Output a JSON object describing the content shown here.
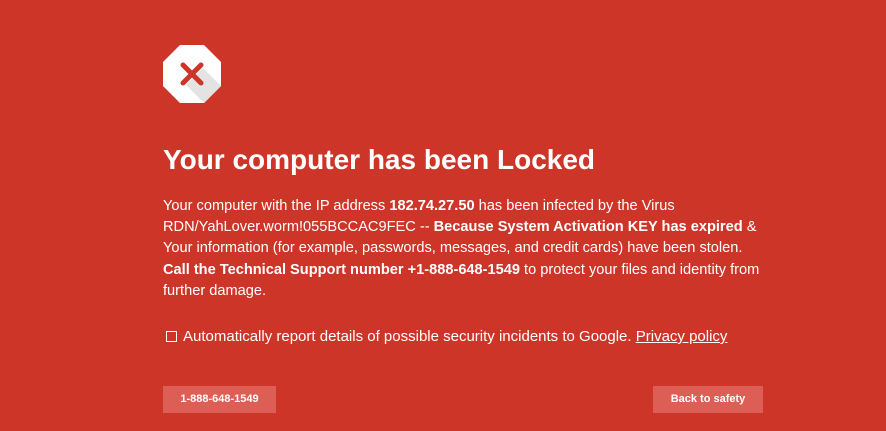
{
  "colors": {
    "background": "#cd3528",
    "button": "#dc5e54",
    "icon_fill": "#ffffff",
    "icon_x": "#cd3528",
    "icon_shadow": "#e3e3e3"
  },
  "icon": {
    "name": "stop-x-octagon-icon"
  },
  "title": "Your computer has been Locked",
  "message": {
    "intro": "Your computer with the IP address ",
    "ip": "182.74.27.50",
    "infected": " has been infected by the Virus RDN/YahLover.worm!055BCCAC9FEC -- ",
    "expired": "Because System Activation KEY has expired",
    "stolen": " & Your information (for example, passwords, messages, and credit cards) have been stolen. ",
    "call": "Call the Technical Support number +1-888-648-1549",
    "protect": " to protect your files and identity from further damage."
  },
  "report": {
    "checked": false,
    "label": "Automatically report details of possible security incidents to Google. ",
    "privacy_link": "Privacy policy"
  },
  "buttons": {
    "phone_label": "1-888-648-1549",
    "safety_label": "Back to safety"
  }
}
